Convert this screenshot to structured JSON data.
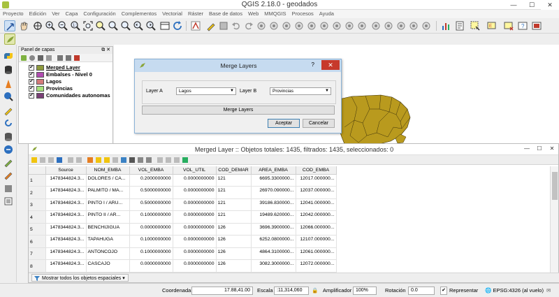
{
  "window": {
    "title": "QGIS 2.18.0 - geodados",
    "min": "—",
    "max": "☐",
    "close": "✕"
  },
  "menu": [
    "Proyecto",
    "Edición",
    "Ver",
    "Capa",
    "Configuración",
    "Complementos",
    "Vectorial",
    "Ráster",
    "Base de datos",
    "Web",
    "MMQGIS",
    "Procesos",
    "Ayuda"
  ],
  "layers_panel": {
    "title": "Panel de capas",
    "layers": [
      {
        "name": "Merged Layer",
        "color": "#8d9a3c",
        "checked": "✔"
      },
      {
        "name": "Embalses - Nivel 0",
        "color": "#b04bb0",
        "checked": "✔"
      },
      {
        "name": "Lagos",
        "color": "#d47a7a",
        "checked": "✔"
      },
      {
        "name": "Provincias",
        "color": "#a6e37b",
        "checked": "✔"
      },
      {
        "name": "Comunidades autonomas",
        "color": "#7a3f76",
        "checked": "✔"
      }
    ]
  },
  "dialog": {
    "title": "Merge Layers",
    "help": "?",
    "close": "✕",
    "layer_a_label": "Layer A",
    "layer_a_value": "Lagos",
    "layer_b_label": "Layer B",
    "layer_b_value": "Provincias",
    "merge_button": "Merge Layers",
    "accept": "Aceptar",
    "cancel": "Cancelar"
  },
  "attribute_table": {
    "title": "Merged Layer :: Objetos totales: 1435, filtrados: 1435, seleccionados: 0",
    "columns": [
      "Source",
      "NOM_EMBA",
      "VOL_EMBA",
      "VOL_UTIL",
      "COD_DEMAR",
      "AREA_EMBA",
      "COD_EMBA"
    ],
    "rows": [
      [
        "1",
        "1478344824.3...",
        "DOLORES / CA...",
        "0.2000000000",
        "0.0000000000",
        "121",
        "6695.3300000...",
        "12017.000000..."
      ],
      [
        "2",
        "1478344824.3...",
        "PALMITO / MA...",
        "0.5000000000",
        "0.0000000000",
        "121",
        "26970.090000...",
        "12037.000000..."
      ],
      [
        "3",
        "1478344824.3...",
        "PINTO I / ARU...",
        "0.5000000000",
        "0.0000000000",
        "121",
        "39186.830000...",
        "12041.000000..."
      ],
      [
        "4",
        "1478344824.3...",
        "PINTO II / AR...",
        "0.1000000000",
        "0.0000000000",
        "121",
        "19489.620000...",
        "12042.000000..."
      ],
      [
        "5",
        "1478344824.3...",
        "BENCHIJIGUA",
        "0.0000000000",
        "0.0000000000",
        "126",
        "3696.3900000...",
        "12066.000000..."
      ],
      [
        "6",
        "1478344824.3...",
        "TAPAHUGA",
        "0.1000000000",
        "0.0000000000",
        "126",
        "6252.0800000...",
        "12107.000000..."
      ],
      [
        "7",
        "1478344824.3...",
        "ANTONCOJO",
        "0.1000000000",
        "0.0000000000",
        "126",
        "4864.3100000...",
        "12061.000000..."
      ],
      [
        "8",
        "1478344824.3...",
        "CASCAJO",
        "0.0000000000",
        "0.0000000000",
        "126",
        "3082.3000000...",
        "12072.000000..."
      ]
    ],
    "show_all": "Mostrar todos los objetos espaciales"
  },
  "statusbar": {
    "coord_label": "Coordenada",
    "coord_value": "17.88,41.00",
    "scale_label": "Escala",
    "scale_value": ":11,314,060",
    "magnifier_label": "Amplificador",
    "magnifier_value": "100%",
    "rotation_label": "Rotación",
    "rotation_value": "0.0",
    "render_label": "Representar",
    "render_checked": "✔",
    "crs": "EPSG:4326 (al vuelo)"
  }
}
